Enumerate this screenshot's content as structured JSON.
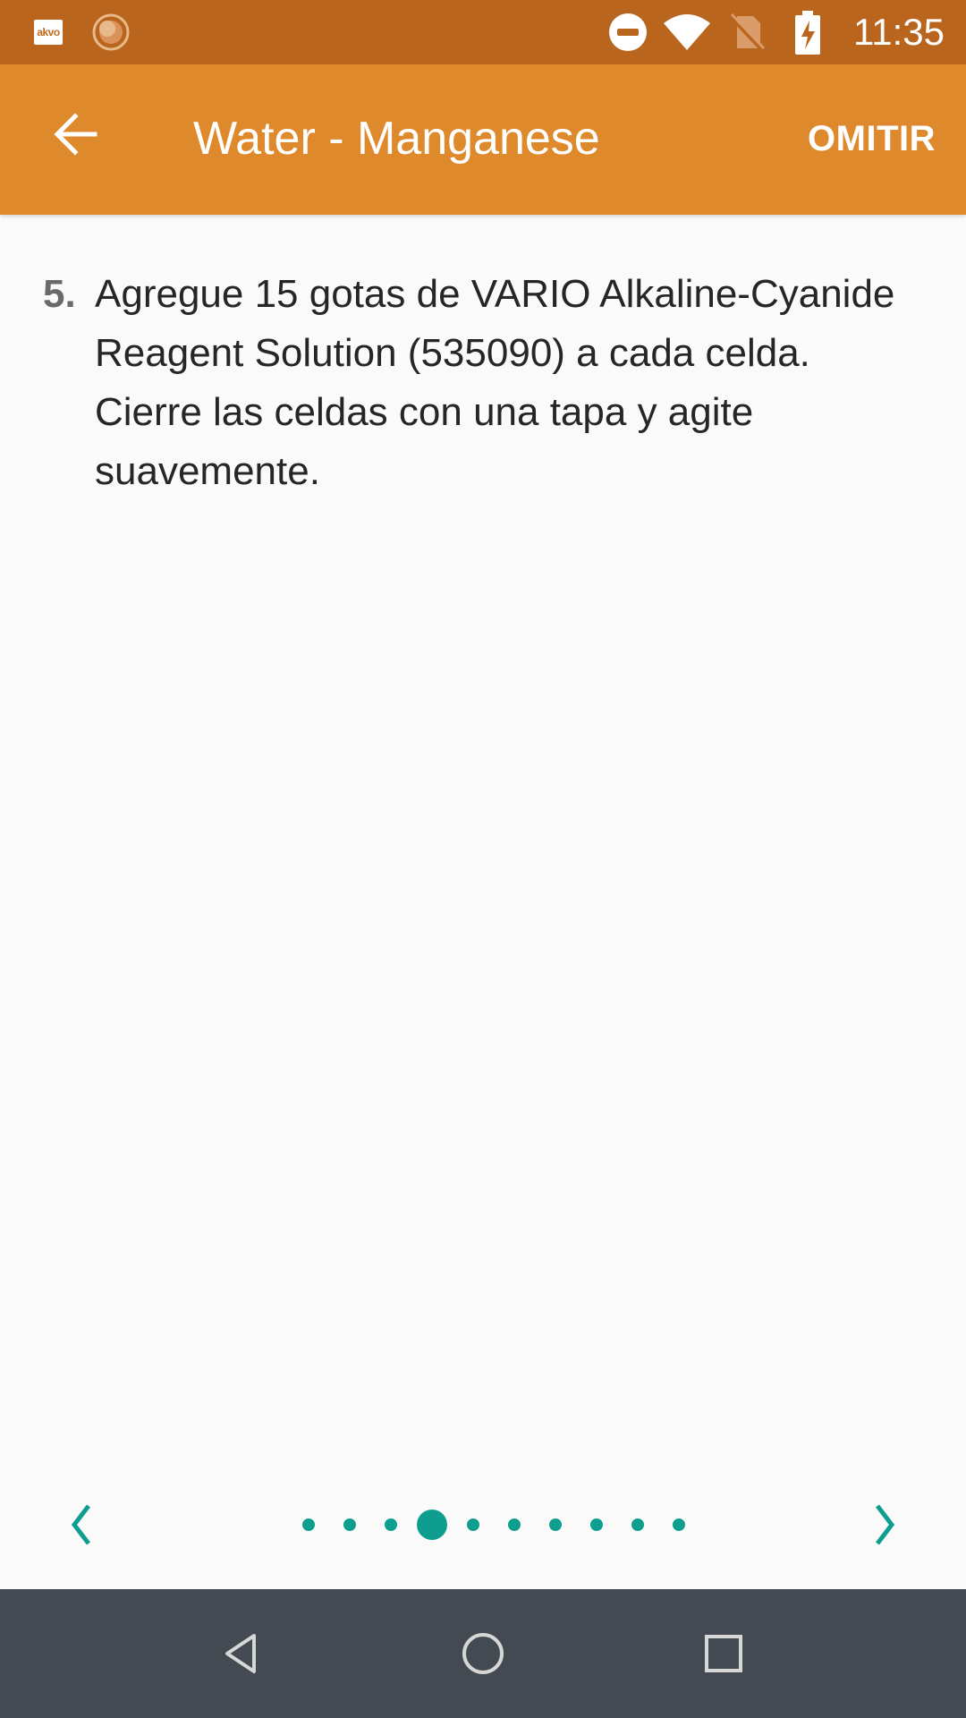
{
  "status_bar": {
    "time": "11:35",
    "app_badge_text": "akvo",
    "icons": [
      "akvo-app-icon",
      "sun-icon",
      "do-not-disturb-icon",
      "wifi-icon",
      "no-sim-icon",
      "battery-charging-icon"
    ]
  },
  "app_bar": {
    "title": "Water - Manganese",
    "skip_label": "OMITIR",
    "back_icon": "arrow-back-icon"
  },
  "instruction": {
    "number": "5.",
    "text": "Agregue 15 gotas de VARIO Alkaline-Cyanide Reagent Solution (535090) a cada celda. Cierre las celdas con una tapa y agite suavemente."
  },
  "pager": {
    "total_pages": 10,
    "current_page": 4,
    "prev_icon": "chevron-left-icon",
    "next_icon": "chevron-right-icon"
  },
  "colors": {
    "status_bar": "#b9651e",
    "app_bar": "#de8a2c",
    "accent": "#0e9e90",
    "nav_bar": "#434a51",
    "background": "#fafafa"
  },
  "nav_bar": {
    "icons": [
      "back-triangle-icon",
      "home-circle-icon",
      "recents-square-icon"
    ]
  }
}
